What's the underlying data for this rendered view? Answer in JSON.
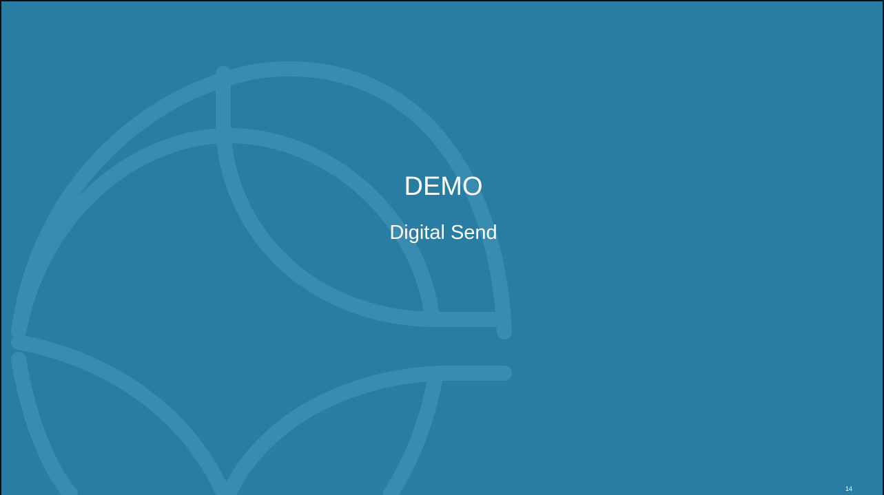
{
  "slide": {
    "title": "DEMO",
    "subtitle": "Digital Send",
    "page_number": "14"
  },
  "colors": {
    "background": "#2a7da2",
    "watermark": "#3a8bb0",
    "text": "#ffffff",
    "frame_border": "#0d0d0d"
  },
  "icons": {
    "watermark": "interlocking-circles-logo-watermark"
  }
}
